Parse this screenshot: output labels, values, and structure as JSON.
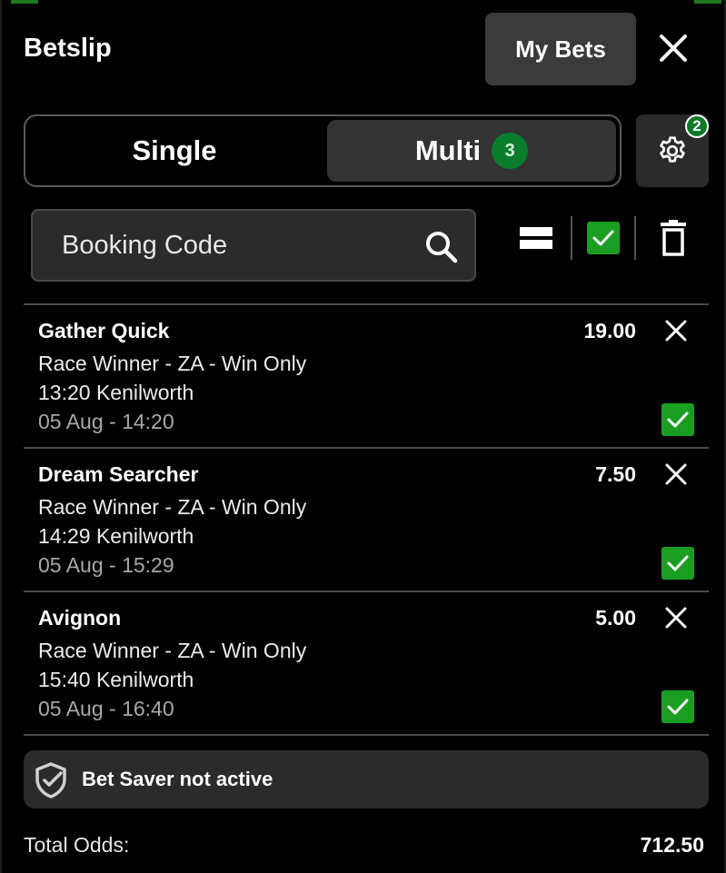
{
  "header": {
    "title": "Betslip",
    "my_bets_label": "My Bets"
  },
  "tabs": {
    "single_label": "Single",
    "multi_label": "Multi",
    "multi_count": "3"
  },
  "settings": {
    "badge_count": "2"
  },
  "booking": {
    "placeholder": "Booking Code"
  },
  "selections": [
    {
      "name": "Gather Quick",
      "odds": "19.00",
      "market": "Race Winner - ZA - Win Only",
      "event": "13:20 Kenilworth",
      "datetime": "05 Aug - 14:20",
      "checked": true
    },
    {
      "name": "Dream Searcher",
      "odds": "7.50",
      "market": "Race Winner - ZA - Win Only",
      "event": "14:29 Kenilworth",
      "datetime": "05 Aug - 15:29",
      "checked": true
    },
    {
      "name": "Avignon",
      "odds": "5.00",
      "market": "Race Winner - ZA - Win Only",
      "event": "15:40 Kenilworth",
      "datetime": "05 Aug - 16:40",
      "checked": true
    }
  ],
  "bet_saver": {
    "label": "Bet Saver not active"
  },
  "totals": {
    "label": "Total Odds:",
    "value": "712.50"
  },
  "colors": {
    "background": "#000000",
    "panel": "#2b2b2b",
    "accent_green": "#1a9e22",
    "badge_green": "#0a7d2c",
    "muted_text": "#a8a8a8"
  },
  "icons": {
    "close": "close-icon",
    "settings": "gear-icon",
    "search": "search-icon",
    "collapse": "collapse-rows-icon",
    "select_all": "checkbox-checked-icon",
    "delete": "trash-icon",
    "bet_saver": "shield-check-icon"
  }
}
